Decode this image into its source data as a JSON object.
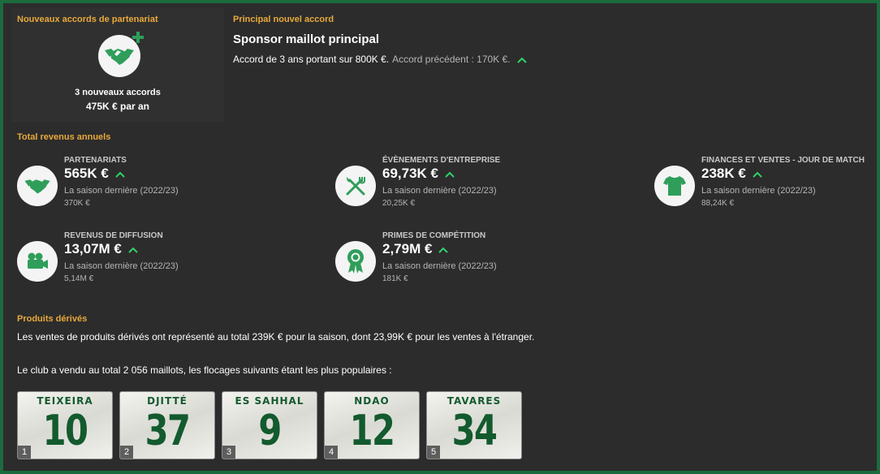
{
  "new_deals": {
    "title": "Nouveaux accords de partenariat",
    "count_text": "3 nouveaux accords",
    "per_year_text": "475K € par an"
  },
  "main_deal": {
    "label": "Principal nouvel accord",
    "title": "Sponsor maillot principal",
    "description": "Accord de 3 ans portant sur 800K €.",
    "previous": "Accord précédent : 170K €."
  },
  "revenue": {
    "title": "Total revenus annuels",
    "items": [
      {
        "label": "PARTENARIATS",
        "value": "565K €",
        "prev_label": "La saison dernière (2022/23)",
        "prev_value": "370K €",
        "icon": "handshake-icon"
      },
      {
        "label": "ÉVÈNEMENTS D'ENTREPRISE",
        "value": "69,73K €",
        "prev_label": "La saison dernière (2022/23)",
        "prev_value": "20,25K €",
        "icon": "cutlery-icon"
      },
      {
        "label": "FINANCES ET VENTES - JOUR DE MATCH",
        "value": "238K €",
        "prev_label": "La saison dernière (2022/23)",
        "prev_value": "88,24K €",
        "icon": "shirt-icon"
      },
      {
        "label": "REVENUS DE DIFFUSION",
        "value": "13,07M €",
        "prev_label": "La saison dernière (2022/23)",
        "prev_value": "5,14M €",
        "icon": "video-camera-icon"
      },
      {
        "label": "PRIMES DE COMPÉTITION",
        "value": "2,79M €",
        "prev_label": "La saison dernière (2022/23)",
        "prev_value": "181K €",
        "icon": "rosette-icon"
      }
    ]
  },
  "merch": {
    "title": "Produits dérivés",
    "sales_text": "Les ventes de produits dérivés ont représenté au total 239K € pour la saison, dont 23,99K € pour les ventes à l'étranger.",
    "shirts_text": "Le club a vendu au total 2 056 maillots, les flocages suivants étant les plus populaires :",
    "jerseys": [
      {
        "name": "TEIXEIRA",
        "number": "10",
        "rank": "1"
      },
      {
        "name": "DJITTÉ",
        "number": "37",
        "rank": "2"
      },
      {
        "name": "ES SAHHAL",
        "number": "9",
        "rank": "3"
      },
      {
        "name": "NDAO",
        "number": "12",
        "rank": "4"
      },
      {
        "name": "TAVARES",
        "number": "34",
        "rank": "5"
      }
    ]
  },
  "colors": {
    "accent_gold": "#e8a93b",
    "up_green": "#2fd36b",
    "icon_green": "#2f9e5a",
    "jersey_green": "#135a2e"
  }
}
